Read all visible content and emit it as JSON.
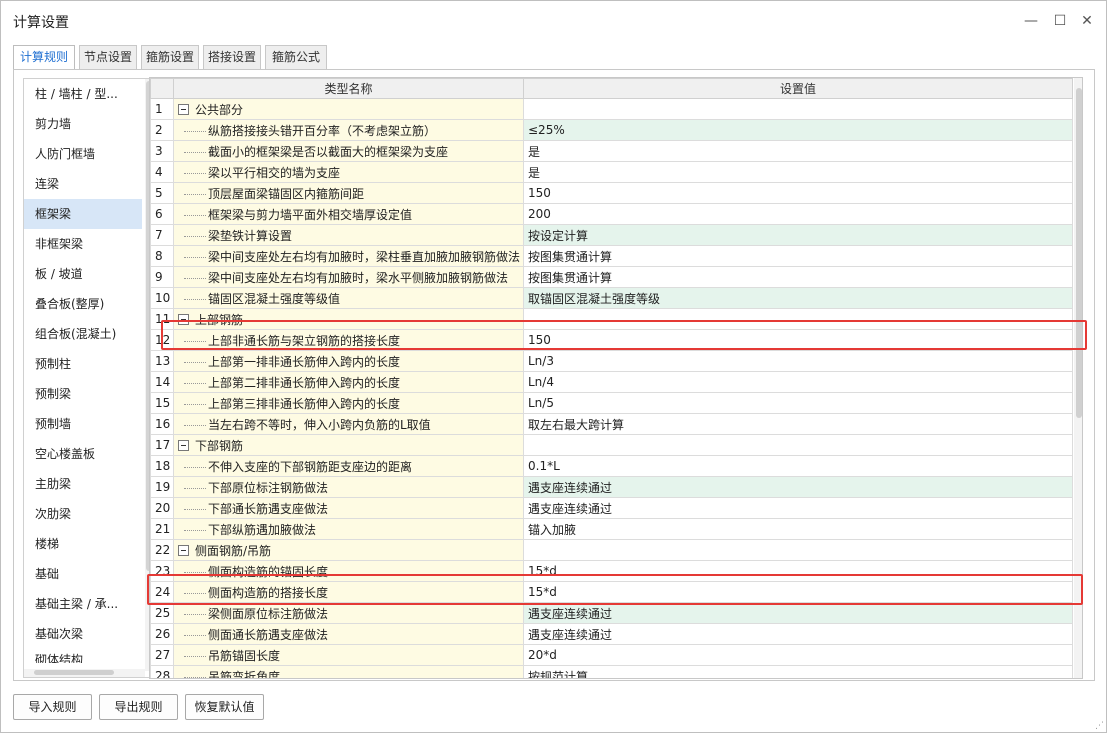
{
  "window": {
    "title": "计算设置",
    "minimize": "—",
    "maximize": "☐",
    "close": "✕"
  },
  "tabs": [
    {
      "label": "计算规则"
    },
    {
      "label": "节点设置"
    },
    {
      "label": "箍筋设置"
    },
    {
      "label": "搭接设置"
    },
    {
      "label": "箍筋公式"
    }
  ],
  "sidebar": {
    "items": [
      {
        "label": "柱 / 墙柱 / 型..."
      },
      {
        "label": "剪力墙"
      },
      {
        "label": "人防门框墙"
      },
      {
        "label": "连梁"
      },
      {
        "label": "框架梁"
      },
      {
        "label": "非框架梁"
      },
      {
        "label": "板 / 坡道"
      },
      {
        "label": "叠合板(整厚)"
      },
      {
        "label": "组合板(混凝土)"
      },
      {
        "label": "预制柱"
      },
      {
        "label": "预制梁"
      },
      {
        "label": "预制墙"
      },
      {
        "label": "空心楼盖板"
      },
      {
        "label": "主肋梁"
      },
      {
        "label": "次肋梁"
      },
      {
        "label": "楼梯"
      },
      {
        "label": "基础"
      },
      {
        "label": "基础主梁 / 承..."
      },
      {
        "label": "基础次梁"
      },
      {
        "label": "砌体结构"
      }
    ]
  },
  "table": {
    "headers": {
      "name": "类型名称",
      "value": "设置值"
    },
    "rows": [
      {
        "n": "1",
        "name": "公共部分",
        "value": ""
      },
      {
        "n": "2",
        "name": "纵筋搭接接头错开百分率（不考虑架立筋）",
        "value": "≤25%"
      },
      {
        "n": "3",
        "name": "截面小的框架梁是否以截面大的框架梁为支座",
        "value": "是"
      },
      {
        "n": "4",
        "name": "梁以平行相交的墙为支座",
        "value": "是"
      },
      {
        "n": "5",
        "name": "顶层屋面梁锚固区内箍筋间距",
        "value": "150"
      },
      {
        "n": "6",
        "name": "框架梁与剪力墙平面外相交墙厚设定值",
        "value": "200"
      },
      {
        "n": "7",
        "name": "梁垫铁计算设置",
        "value": "按设定计算"
      },
      {
        "n": "8",
        "name": "梁中间支座处左右均有加腋时，梁柱垂直加腋加腋钢筋做法",
        "value": "按图集贯通计算"
      },
      {
        "n": "9",
        "name": "梁中间支座处左右均有加腋时，梁水平侧腋加腋钢筋做法",
        "value": "按图集贯通计算"
      },
      {
        "n": "10",
        "name": "锚固区混凝土强度等级值",
        "value": "取锚固区混凝土强度等级"
      },
      {
        "n": "11",
        "name": "上部钢筋",
        "value": ""
      },
      {
        "n": "12",
        "name": "上部非通长筋与架立钢筋的搭接长度",
        "value": "150"
      },
      {
        "n": "13",
        "name": "上部第一排非通长筋伸入跨内的长度",
        "value": "Ln/3"
      },
      {
        "n": "14",
        "name": "上部第二排非通长筋伸入跨内的长度",
        "value": "Ln/4"
      },
      {
        "n": "15",
        "name": "上部第三排非通长筋伸入跨内的长度",
        "value": "Ln/5"
      },
      {
        "n": "16",
        "name": "当左右跨不等时，伸入小跨内负筋的L取值",
        "value": "取左右最大跨计算"
      },
      {
        "n": "17",
        "name": "下部钢筋",
        "value": ""
      },
      {
        "n": "18",
        "name": "不伸入支座的下部钢筋距支座边的距离",
        "value": "0.1*L"
      },
      {
        "n": "19",
        "name": "下部原位标注钢筋做法",
        "value": "遇支座连续通过"
      },
      {
        "n": "20",
        "name": "下部通长筋遇支座做法",
        "value": "遇支座连续通过"
      },
      {
        "n": "21",
        "name": "下部纵筋遇加腋做法",
        "value": "锚入加腋"
      },
      {
        "n": "22",
        "name": "侧面钢筋/吊筋",
        "value": ""
      },
      {
        "n": "23",
        "name": "侧面构造筋的锚固长度",
        "value": "15*d"
      },
      {
        "n": "24",
        "name": "侧面构造筋的搭接长度",
        "value": "15*d"
      },
      {
        "n": "25",
        "name": "梁侧面原位标注筋做法",
        "value": "遇支座连续通过"
      },
      {
        "n": "26",
        "name": "侧面通长筋遇支座做法",
        "value": "遇支座连续通过"
      },
      {
        "n": "27",
        "name": "吊筋锚固长度",
        "value": "20*d"
      },
      {
        "n": "28",
        "name": "吊筋弯折角度",
        "value": "按规范计算"
      }
    ]
  },
  "buttons": {
    "import": "导入规则",
    "export": "导出规则",
    "restore": "恢复默认值"
  },
  "colors": {
    "highlight_box": "#e53935",
    "value_highlight": "#e5f4ec",
    "name_column": "#fefbe3",
    "sidebar_selected": "#d7e6f7",
    "active_tab_text": "#1f6fd1"
  }
}
